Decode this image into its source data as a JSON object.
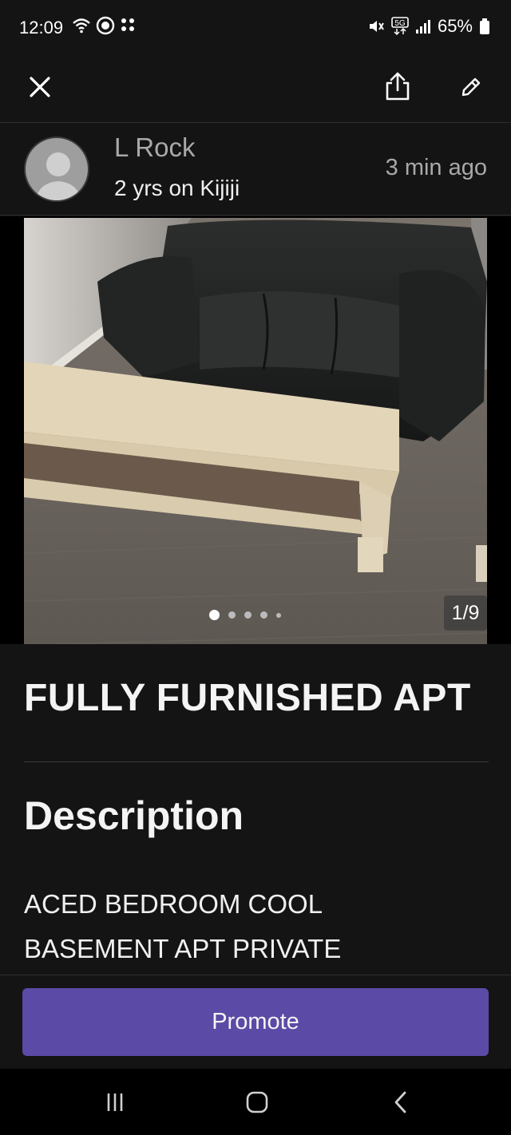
{
  "status_bar": {
    "time": "12:09",
    "battery_percent": "65%",
    "icons": [
      "wifi-icon",
      "record-icon",
      "dots-icon",
      "mute-icon",
      "5g-icon",
      "signal-icon",
      "battery-icon"
    ]
  },
  "app_bar": {
    "icons": [
      "close-icon",
      "share-icon",
      "edit-icon"
    ]
  },
  "seller": {
    "name": "L Rock",
    "tenure": "2 yrs on Kijiji",
    "posted": "3 min  ago"
  },
  "photo": {
    "counter": "1/9",
    "current_index": 1,
    "total": 9
  },
  "listing": {
    "title": "FULLY FURNISHED APT",
    "description_heading": "Description",
    "description_line_1": "ACED BEDROOM COOL",
    "description_line_2": "BASEMENT APT PRIVATE"
  },
  "actions": {
    "promote_label": "Promote"
  },
  "colors": {
    "background": "#141414",
    "accent": "#5b4aa6",
    "muted_text": "#a9a9a9"
  }
}
